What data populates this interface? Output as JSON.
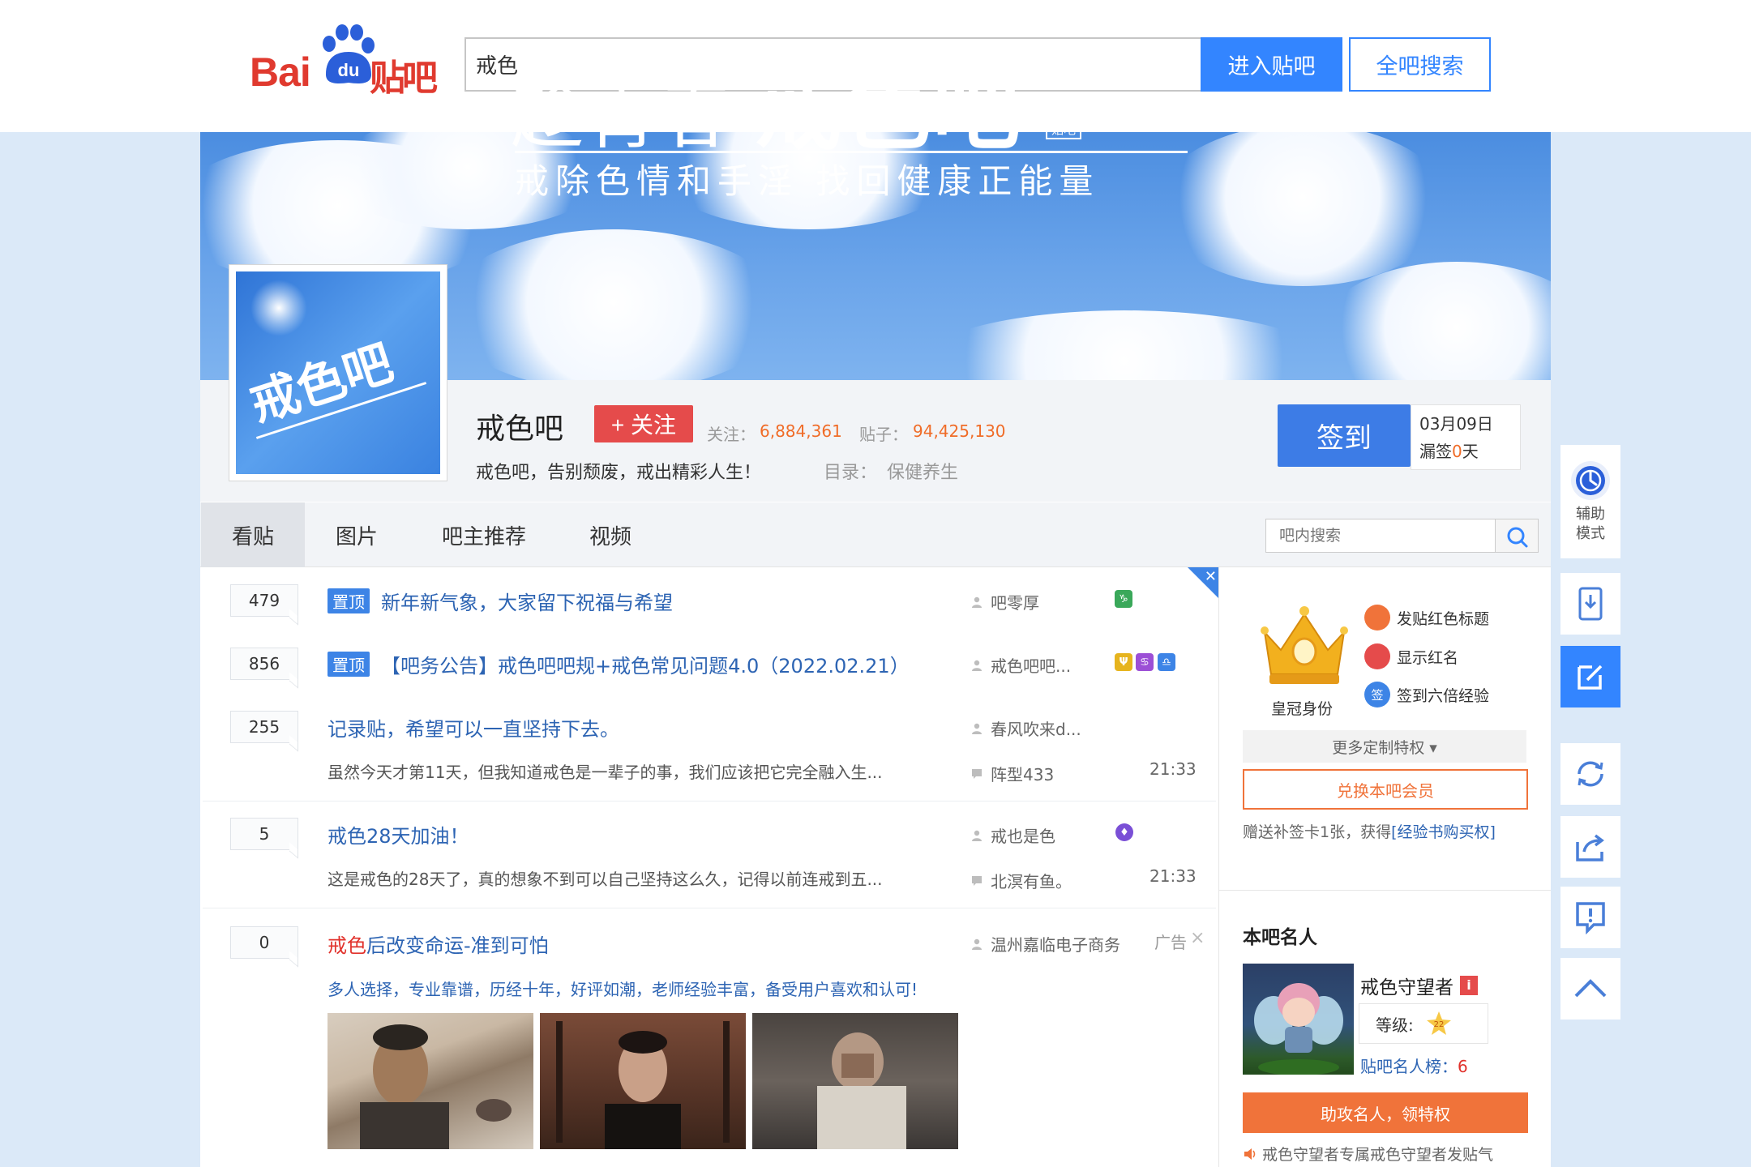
{
  "header": {
    "logo_text_bai": "Bai",
    "logo_text_du": "du",
    "logo_text_tieba": "贴吧",
    "search_value": "戒色",
    "enter_button": "进入贴吧",
    "all_search_button": "全吧搜索"
  },
  "banner": {
    "title_prefix": "趁青春",
    "title_main": "戒色吧",
    "seal": "百度贴吧",
    "subtitle": "戒除色情和手淫 找回健康正能量",
    "avatar_text": "戒色吧"
  },
  "forum": {
    "name": "戒色吧",
    "follow_button": "+ 关注",
    "followers_label": "关注：",
    "followers_value": "6,884,361",
    "posts_label": "贴子：",
    "posts_value": "94,425,130",
    "slogan": "戒色吧，告别颓废，戒出精彩人生！",
    "catalog_label": "目录：",
    "catalog_value": "保健养生",
    "sign_button": "签到",
    "sign_date": "03月09日",
    "sign_missed_prefix": "漏签",
    "sign_missed_value": "0",
    "sign_missed_suffix": "天"
  },
  "tabs": [
    "看贴",
    "图片",
    "吧主推荐",
    "视频"
  ],
  "inner_search_placeholder": "吧内搜索",
  "threads": [
    {
      "count": "479",
      "pinned": "置顶",
      "title": "新年新气象，大家留下祝福与希望",
      "author": "吧零厚"
    },
    {
      "count": "856",
      "pinned": "置顶",
      "title": "【吧务公告】戒色吧吧规+戒色常见问题4.0（2022.02.21）",
      "author": "戒色吧吧..."
    },
    {
      "count": "255",
      "title": "记录贴，希望可以一直坚持下去。",
      "author": "春风吹来d...",
      "abstract": "虽然今天才第11天，但我知道戒色是一辈子的事，我们应该把它完全融入生...",
      "last_reply": "阵型433",
      "time": "21:33"
    },
    {
      "count": "5",
      "title": "戒色28天加油！",
      "author": "戒也是色",
      "abstract": "这是戒色的28天了，真的想象不到可以自己坚持这么久，记得以前连戒到五...",
      "last_reply": "北溟有鱼。",
      "time": "21:33"
    }
  ],
  "ad": {
    "count": "0",
    "title_red": "戒色",
    "title_rest": "后改变命运-准到可怕",
    "advertiser": "温州嘉临电子商务",
    "ad_label": "广告",
    "close": "×",
    "desc": "多人选择，专业靠谱，历经十年，好评如潮，老师经验丰富，备受用户喜欢和认可!"
  },
  "sidebar": {
    "crown_label": "皇冠身份",
    "privileges": [
      "发贴红色标题",
      "显示红名",
      "签到六倍经验"
    ],
    "privilege_icons": [
      "bookmark-icon",
      "chat-icon",
      "sign-icon"
    ],
    "privilege_icon_glyphs": [
      "",
      "",
      "签"
    ],
    "more_privileges": "更多定制特权 ▾",
    "redeem_button": "兑换本吧会员",
    "gift_text": "赠送补签卡1张，获得",
    "gift_link": "[经验书购买权]",
    "famous_heading": "本吧名人",
    "famous_name": "戒色守望者",
    "famous_badge": "i",
    "level_label": "等级:",
    "level_value": "22",
    "rank_label": "贴吧名人榜：",
    "rank_value": "6",
    "help_button": "助攻名人，领特权",
    "guard_text": "戒色守望者专属戒色守望者发贴气"
  },
  "right_rail": {
    "assist_label_1": "辅助",
    "assist_label_2": "模式"
  },
  "colors": {
    "brand_blue": "#3385ff",
    "brand_red": "#e03a2f",
    "link_blue": "#2d64b3",
    "orange": "#f06c28"
  }
}
